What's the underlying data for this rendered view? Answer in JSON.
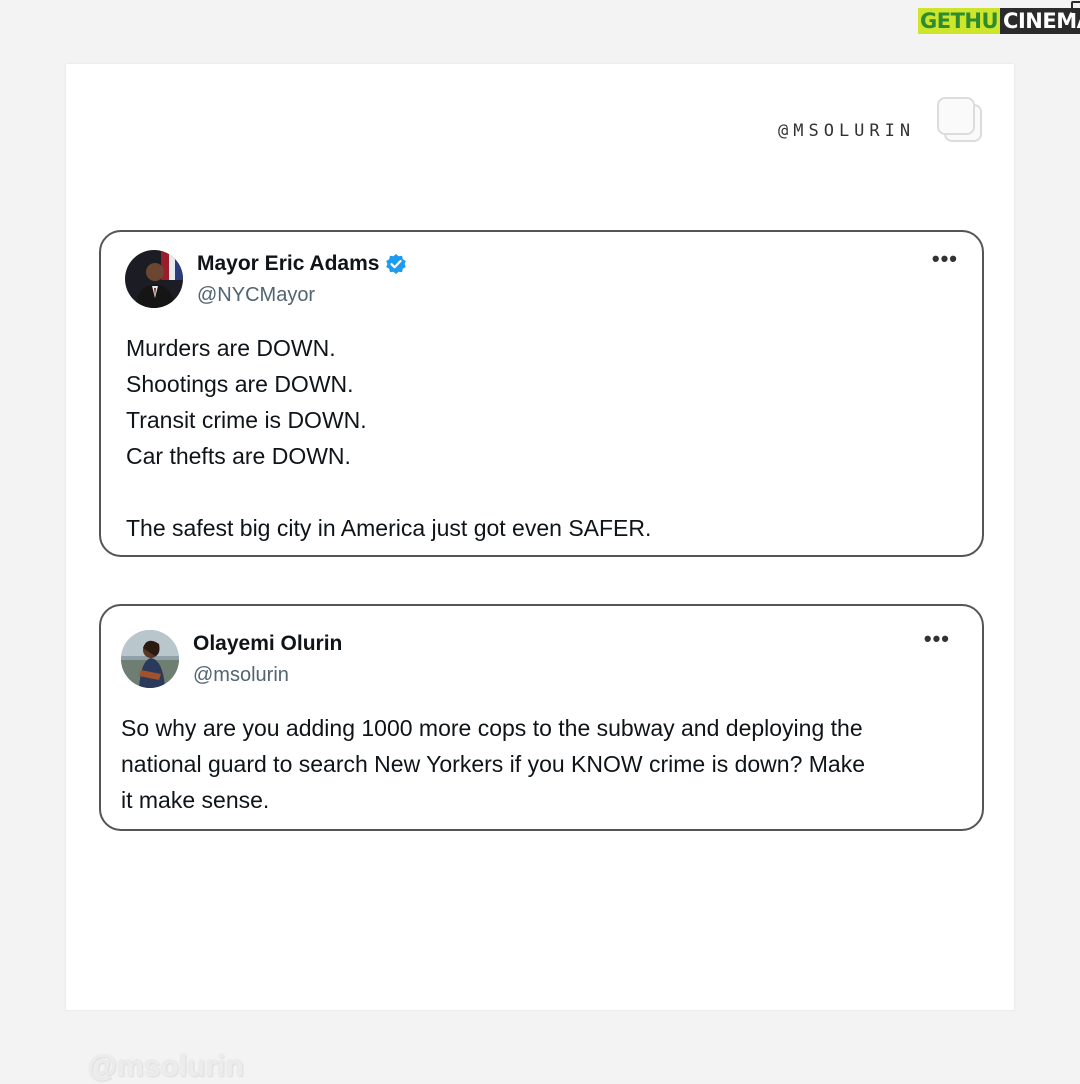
{
  "brand": {
    "part1": "GETHU",
    "part2": "CINEMA"
  },
  "watermark_top": "@MSOLURIN",
  "tweets": [
    {
      "name": "Mayor Eric Adams",
      "handle": "@NYCMayor",
      "verified": true,
      "lines": [
        "Murders are DOWN.",
        "Shootings are DOWN.",
        "Transit crime is DOWN.",
        "Car thefts are DOWN."
      ],
      "closing": "The safest big city in America just got even SAFER."
    },
    {
      "name": "Olayemi Olurin",
      "handle": "@msolurin",
      "verified": false,
      "lines": [
        "So why are you adding 1000 more cops to the subway and deploying the",
        "national guard to search New Yorkers if you KNOW crime is down? Make",
        "it make sense."
      ]
    }
  ],
  "more_icon": "more-horizontal-icon",
  "verified_color": "#1d9bf0",
  "watermark_bottom": "@msolurin"
}
